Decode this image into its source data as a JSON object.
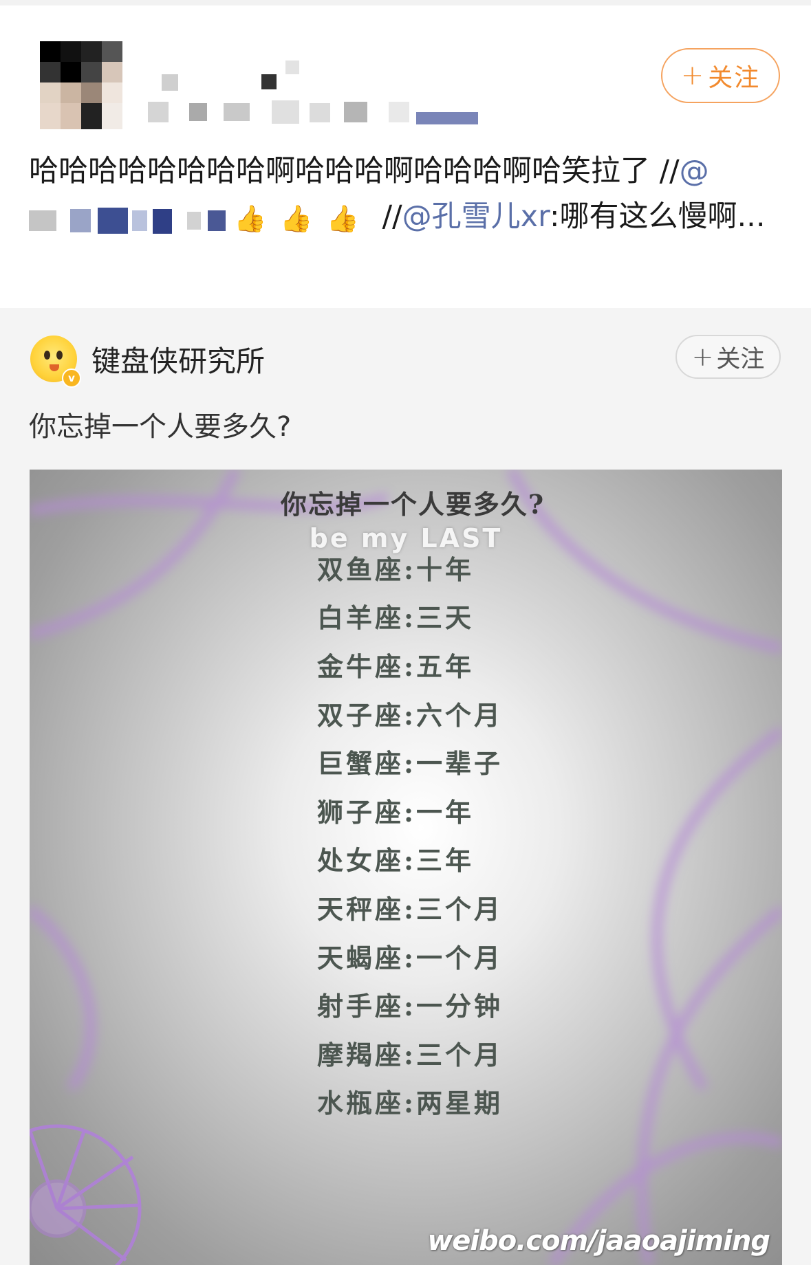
{
  "repost": {
    "follow_label": "关注",
    "text_main": "哈哈哈哈哈哈哈哈啊哈哈哈啊哈哈哈啊哈笑拉了 //",
    "mention_at": "@",
    "thumbs": [
      "👍",
      "👍",
      "👍"
    ],
    "quote_prefix": " //",
    "quote_mention": "@孔雪儿xr",
    "quote_text": ":哪有这么慢啊..."
  },
  "original": {
    "author": "键盘侠研究所",
    "follow_label": "关注",
    "text": "你忘掉一个人要多久?",
    "image": {
      "title": "你忘掉一个人要多久?",
      "subtitle": "be my LAST",
      "rows": [
        {
          "sign": "双鱼座:",
          "duration": "十年"
        },
        {
          "sign": "白羊座:",
          "duration": "三天"
        },
        {
          "sign": "金牛座:",
          "duration": "五年"
        },
        {
          "sign": "双子座:",
          "duration": "六个月"
        },
        {
          "sign": "巨蟹座:",
          "duration": "一辈子"
        },
        {
          "sign": "狮子座:",
          "duration": "一年"
        },
        {
          "sign": "处女座:",
          "duration": "三年"
        },
        {
          "sign": "天秤座:",
          "duration": "三个月"
        },
        {
          "sign": "天蝎座:",
          "duration": "一个月"
        },
        {
          "sign": "射手座:",
          "duration": "一分钟"
        },
        {
          "sign": "摩羯座:",
          "duration": "三个月"
        },
        {
          "sign": "水瓶座:",
          "duration": "两星期"
        }
      ],
      "watermark": "weibo.com/jaaoajiming"
    }
  },
  "colors": {
    "follow_orange": "#f28a2e",
    "mention_blue": "#5a6fa8",
    "card_bg": "#f4f4f4"
  }
}
